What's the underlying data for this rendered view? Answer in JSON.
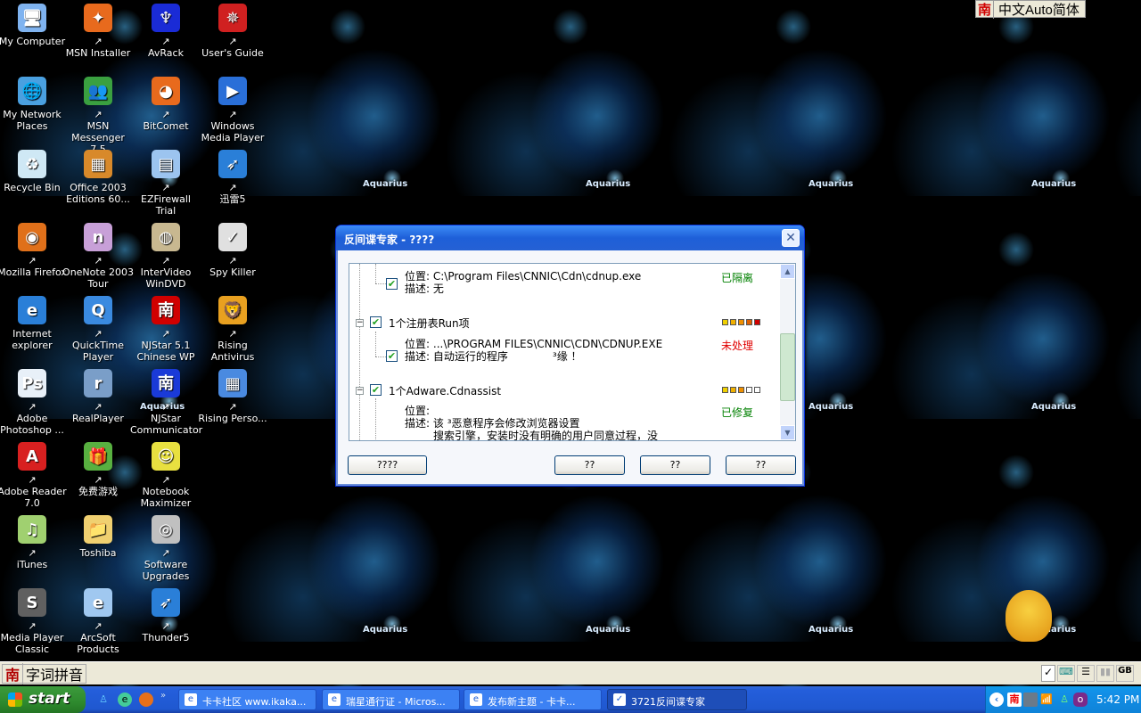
{
  "wallpaper": {
    "label": "Aquarius"
  },
  "desktop_icons": [
    {
      "label": "My Computer",
      "color": "#7fb3f0",
      "glyph": "🖥",
      "shortcut": false
    },
    {
      "label": "MSN Installer",
      "color": "#e86a1d",
      "glyph": "✦",
      "shortcut": true
    },
    {
      "label": "AvRack",
      "color": "#1a2bd6",
      "glyph": "♆",
      "shortcut": true
    },
    {
      "label": "User's Guide",
      "color": "#d02020",
      "glyph": "✵",
      "shortcut": true
    },
    {
      "label": "My Network Places",
      "color": "#4aa0e0",
      "glyph": "🌐",
      "shortcut": false
    },
    {
      "label": "MSN Messenger 7.5",
      "color": "#3aa040",
      "glyph": "👥",
      "shortcut": true
    },
    {
      "label": "BitComet",
      "color": "#e86a1d",
      "glyph": "◕",
      "shortcut": true
    },
    {
      "label": "Windows Media Player",
      "color": "#2a6fd8",
      "glyph": "▶",
      "shortcut": true
    },
    {
      "label": "Recycle Bin",
      "color": "#cfe8f5",
      "glyph": "♻",
      "shortcut": false
    },
    {
      "label": "Office 2003 Editions 60...",
      "color": "#d8892a",
      "glyph": "▦",
      "shortcut": false
    },
    {
      "label": "EZFirewall Trial",
      "color": "#9cc4ef",
      "glyph": "▤",
      "shortcut": true
    },
    {
      "label": "迅雷5",
      "color": "#2a7fd8",
      "glyph": "➶",
      "shortcut": true
    },
    {
      "label": "Mozilla Firefox",
      "color": "#e0701a",
      "glyph": "◉",
      "shortcut": true
    },
    {
      "label": "OneNote 2003 Tour",
      "color": "#c8a0d8",
      "glyph": "n",
      "shortcut": true
    },
    {
      "label": "InterVideo WinDVD",
      "color": "#c8b890",
      "glyph": "◍",
      "shortcut": true
    },
    {
      "label": "Spy Killer",
      "color": "#e0e0e0",
      "glyph": "✓",
      "shortcut": true
    },
    {
      "label": "Internet explorer",
      "color": "#2a7fd8",
      "glyph": "e",
      "shortcut": false
    },
    {
      "label": "QuickTime Player",
      "color": "#3a8ae0",
      "glyph": "Q",
      "shortcut": true
    },
    {
      "label": "NJStar 5.1 Chinese WP",
      "color": "#d00000",
      "glyph": "南",
      "shortcut": true
    },
    {
      "label": "Rising Antivirus",
      "color": "#e8a020",
      "glyph": "🦁",
      "shortcut": true
    },
    {
      "label": "Adobe Photoshop ...",
      "color": "#e8f0f8",
      "glyph": "Ps",
      "shortcut": true
    },
    {
      "label": "RealPlayer",
      "color": "#7a9ec8",
      "glyph": "r",
      "shortcut": true
    },
    {
      "label": "NJStar Communicator",
      "color": "#1a3ad8",
      "glyph": "南",
      "shortcut": true
    },
    {
      "label": "Rising Perso...",
      "color": "#4a8ae0",
      "glyph": "▦",
      "shortcut": true
    },
    {
      "label": "Adobe Reader 7.0",
      "color": "#d82020",
      "glyph": "A",
      "shortcut": true
    },
    {
      "label": "免费游戏",
      "color": "#58b040",
      "glyph": "🎁",
      "shortcut": true
    },
    {
      "label": "Notebook Maximizer",
      "color": "#e8e040",
      "glyph": "☺",
      "shortcut": true
    },
    {
      "label": "",
      "color": "",
      "glyph": "",
      "shortcut": false
    },
    {
      "label": "iTunes",
      "color": "#a0d070",
      "glyph": "♫",
      "shortcut": true
    },
    {
      "label": "Toshiba",
      "color": "#f0d070",
      "glyph": "📁",
      "shortcut": false
    },
    {
      "label": "Software Upgrades",
      "color": "#c0c0c0",
      "glyph": "◎",
      "shortcut": true
    },
    {
      "label": "",
      "color": "",
      "glyph": "",
      "shortcut": false
    },
    {
      "label": "Media Player Classic",
      "color": "#606060",
      "glyph": "S",
      "shortcut": true
    },
    {
      "label": "ArcSoft Products",
      "color": "#a0c8f0",
      "glyph": "e",
      "shortcut": true
    },
    {
      "label": "Thunder5",
      "color": "#2a7fd8",
      "glyph": "➶",
      "shortcut": true
    }
  ],
  "ime_top": {
    "logo": "南",
    "label": "中文Auto简体"
  },
  "dialog": {
    "title": "反间谍专家 - ????",
    "close_icon": "close-icon",
    "items": [
      {
        "type": "detail",
        "location_label": "位置:",
        "location": "C:\\Program Files\\CNNIC\\Cdn\\cdnup.exe",
        "desc_label": "描述:",
        "desc": "无",
        "status": "已隔离",
        "status_color": "#008000",
        "checked": true
      },
      {
        "type": "group",
        "label": "1个注册表Run项",
        "checked": true,
        "level": 5,
        "level_max": 5
      },
      {
        "type": "detail",
        "location_label": "位置:",
        "location": "...\\PROGRAM FILES\\CNNIC\\CDN\\CDNUP.EXE",
        "desc_label": "描述:",
        "desc": "自动运行的程序",
        "desc_tail": "³缘 ！",
        "status": "未处理",
        "status_color": "#e00000",
        "checked": true
      },
      {
        "type": "group",
        "label": "1个Adware.Cdnassist",
        "checked": true,
        "level": 3,
        "level_max": 5
      },
      {
        "type": "detail",
        "location_label": "位置:",
        "location": "",
        "desc_label": "描述:",
        "desc": "该 ³恶意程序会修改浏览器设置",
        "desc_line2": "搜索引擎，安装时没有明确的用户同意过程，没",
        "status": "已修复",
        "status_color": "#008000",
        "checked": false
      }
    ],
    "buttons": [
      "????",
      "??",
      "??",
      "??"
    ]
  },
  "ime_bar": {
    "logo": "南",
    "label": "字词拼音",
    "right_icons": [
      "check-icon",
      "keyboard-icon",
      "panel-icon",
      "bars-icon",
      "gb-icon"
    ],
    "gb_label": "GB"
  },
  "taskbar": {
    "start_label": "start",
    "quicklaunch": [
      "msn-icon",
      "ie-icon",
      "firefox-icon"
    ],
    "tasks": [
      {
        "label": "卡卡社区 www.ikaka...",
        "active": false
      },
      {
        "label": "瑞星通行证 - Micros...",
        "active": false
      },
      {
        "label": "发布新主题 - 卡卡...",
        "active": false
      },
      {
        "label": "3721反间谍专家",
        "active": true
      }
    ],
    "tray_icons": [
      "chevron-left-icon",
      "njstar-icon",
      "network-icon",
      "wireless-icon",
      "msn-icon",
      "app-icon"
    ],
    "clock": "5:42 PM"
  }
}
